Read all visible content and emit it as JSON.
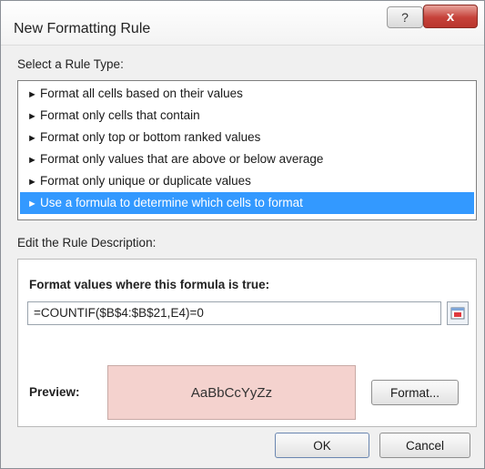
{
  "window": {
    "title": "New Formatting Rule",
    "help_label": "?",
    "close_label": "x"
  },
  "rule_type": {
    "label": "Select a Rule Type:",
    "items": [
      {
        "label": "Format all cells based on their values"
      },
      {
        "label": "Format only cells that contain"
      },
      {
        "label": "Format only top or bottom ranked values"
      },
      {
        "label": "Format only values that are above or below average"
      },
      {
        "label": "Format only unique or duplicate values"
      },
      {
        "label": "Use a formula to determine which cells to format"
      }
    ],
    "selected_index": 5,
    "bullet": "►"
  },
  "description": {
    "label": "Edit the Rule Description:",
    "formula_label": "Format values where this formula is true:",
    "formula_value": "=COUNTIF($B$4:$B$21,E4)=0",
    "preview_label": "Preview:",
    "preview_text": "AaBbCcYyZz",
    "preview_color": "#f4d2ce",
    "format_button": "Format..."
  },
  "footer": {
    "ok_label": "OK",
    "cancel_label": "Cancel"
  },
  "colors": {
    "selection": "#3399ff",
    "close_button": "#c6423a"
  }
}
